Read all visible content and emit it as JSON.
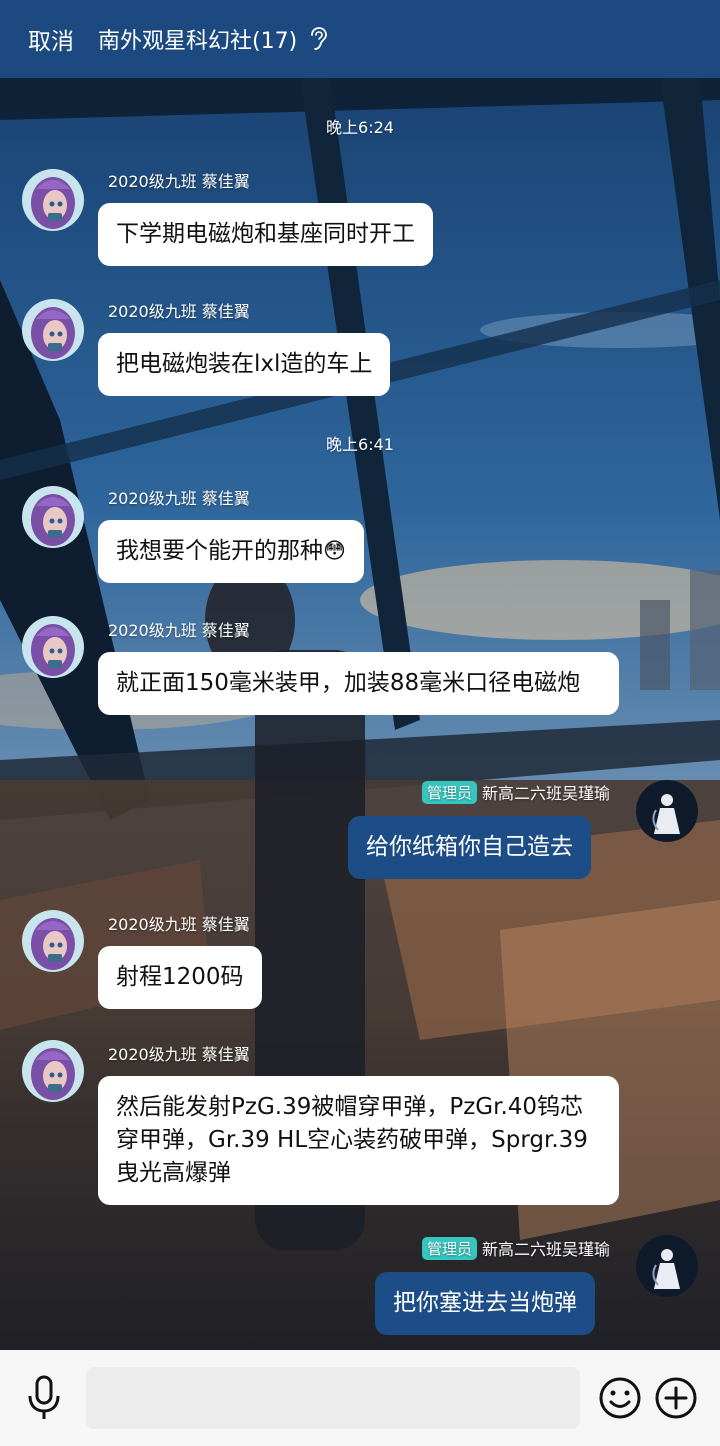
{
  "header": {
    "cancel_label": "取消",
    "title": "南外观星科幻社(17)",
    "listen_icon": "ear-icon"
  },
  "timestamps": [
    "晚上6:24",
    "晚上6:41"
  ],
  "messages": [
    {
      "sender": "2020级九班 蔡佳翼",
      "text": "下学期电磁炮和基座同时开工"
    },
    {
      "sender": "2020级九班 蔡佳翼",
      "text": "把电磁炮装在lxl造的车上"
    },
    {
      "sender": "2020级九班 蔡佳翼",
      "text": "我想要个能开的那种",
      "emoji": "😳"
    },
    {
      "sender": "2020级九班 蔡佳翼",
      "text": "就正面150毫米装甲，加装88毫米口径电磁炮"
    },
    {
      "badge": "管理员",
      "sender": "新高二六班吴瑾瑜",
      "text": "给你纸箱你自己造去"
    },
    {
      "sender": "2020级九班 蔡佳翼",
      "text": "射程1200码"
    },
    {
      "sender": "2020级九班 蔡佳翼",
      "text": "然后能发射PzG.39被帽穿甲弹，PzGr.40钨芯穿甲弹，Gr.39 HL空心装药破甲弹，Sprgr.39曳光高爆弹"
    },
    {
      "badge": "管理员",
      "sender": "新高二六班吴瑾瑜",
      "text": "把你塞进去当炮弹"
    }
  ],
  "composer": {
    "placeholder": "",
    "mic_icon": "mic-icon",
    "emoji_icon": "smile-icon",
    "plus_icon": "plus-icon"
  },
  "colors": {
    "header": "#1c4a80",
    "my_bubble": "#1d4d86",
    "admin_badge": "#36c6c0"
  }
}
